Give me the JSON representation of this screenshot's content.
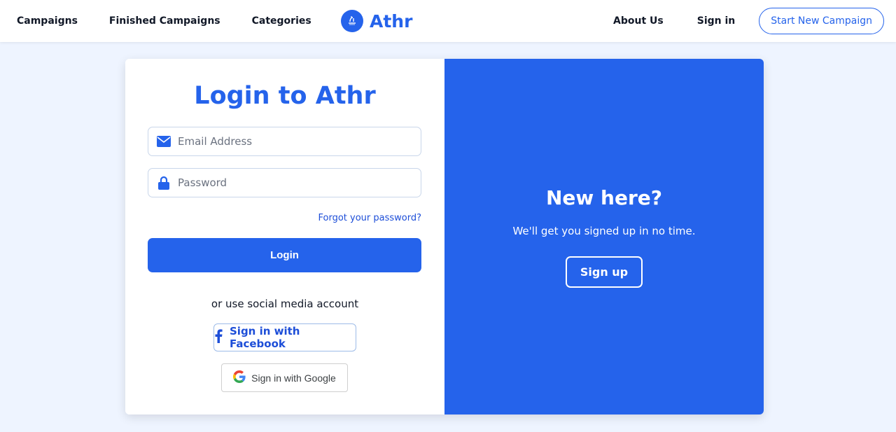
{
  "nav": {
    "links_left": [
      "Campaigns",
      "Finished Campaigns",
      "Categories"
    ],
    "brand_name": "Athr",
    "about": "About Us",
    "signin": "Sign in",
    "start_campaign": "Start New Campaign"
  },
  "login": {
    "title": "Login to Athr",
    "email_placeholder": "Email Address",
    "password_placeholder": "Password",
    "forgot": "Forgot your password?",
    "button": "Login",
    "social_text": "or use social media account",
    "facebook": "Sign in with Facebook",
    "google": "Sign in with Google"
  },
  "signup": {
    "title": "New here?",
    "subtitle": "We'll get you signed up in no time.",
    "button": "Sign up"
  },
  "icons": {
    "logo": "athr-logo-icon",
    "email": "envelope-icon",
    "password": "lock-icon",
    "facebook": "facebook-icon",
    "google": "google-icon"
  },
  "colors": {
    "primary": "#2563eb",
    "background": "#eef4ff",
    "white": "#ffffff"
  }
}
